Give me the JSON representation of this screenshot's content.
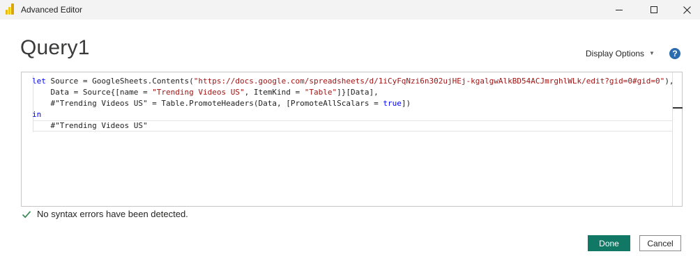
{
  "window": {
    "title": "Advanced Editor"
  },
  "header": {
    "query_name": "Query1",
    "display_options_label": "Display Options",
    "help_label": "?"
  },
  "editor": {
    "lines": [
      [
        {
          "t": "let",
          "c": "kw"
        },
        {
          "t": " Source = GoogleSheets.Contents(",
          "c": ""
        },
        {
          "t": "\"https://docs.google.com/spreadsheets/d/1iCyFqNzi6n302ujHEj-kgalgwAlkBD54ACJmrghlWLk/edit?gid=0#gid=0\"",
          "c": "str"
        },
        {
          "t": "),",
          "c": ""
        }
      ],
      [
        {
          "t": "    Data = Source{[name = ",
          "c": ""
        },
        {
          "t": "\"Trending Videos US\"",
          "c": "str"
        },
        {
          "t": ", ItemKind = ",
          "c": ""
        },
        {
          "t": "\"Table\"",
          "c": "str"
        },
        {
          "t": "]}[Data],",
          "c": ""
        }
      ],
      [
        {
          "t": "    #\"Trending Videos US\" = Table.PromoteHeaders(Data, [PromoteAllScalars = ",
          "c": ""
        },
        {
          "t": "true",
          "c": "kw"
        },
        {
          "t": "])",
          "c": ""
        }
      ],
      [
        {
          "t": "in",
          "c": "kw"
        }
      ],
      [
        {
          "t": "    #\"Trending Videos US\"",
          "c": ""
        }
      ]
    ]
  },
  "status": {
    "message": "No syntax errors have been detected."
  },
  "buttons": {
    "done": "Done",
    "cancel": "Cancel"
  },
  "colors": {
    "done_button": "#117865",
    "keyword": "#0000ff",
    "string": "#a31515",
    "check": "#3c8d5b"
  }
}
